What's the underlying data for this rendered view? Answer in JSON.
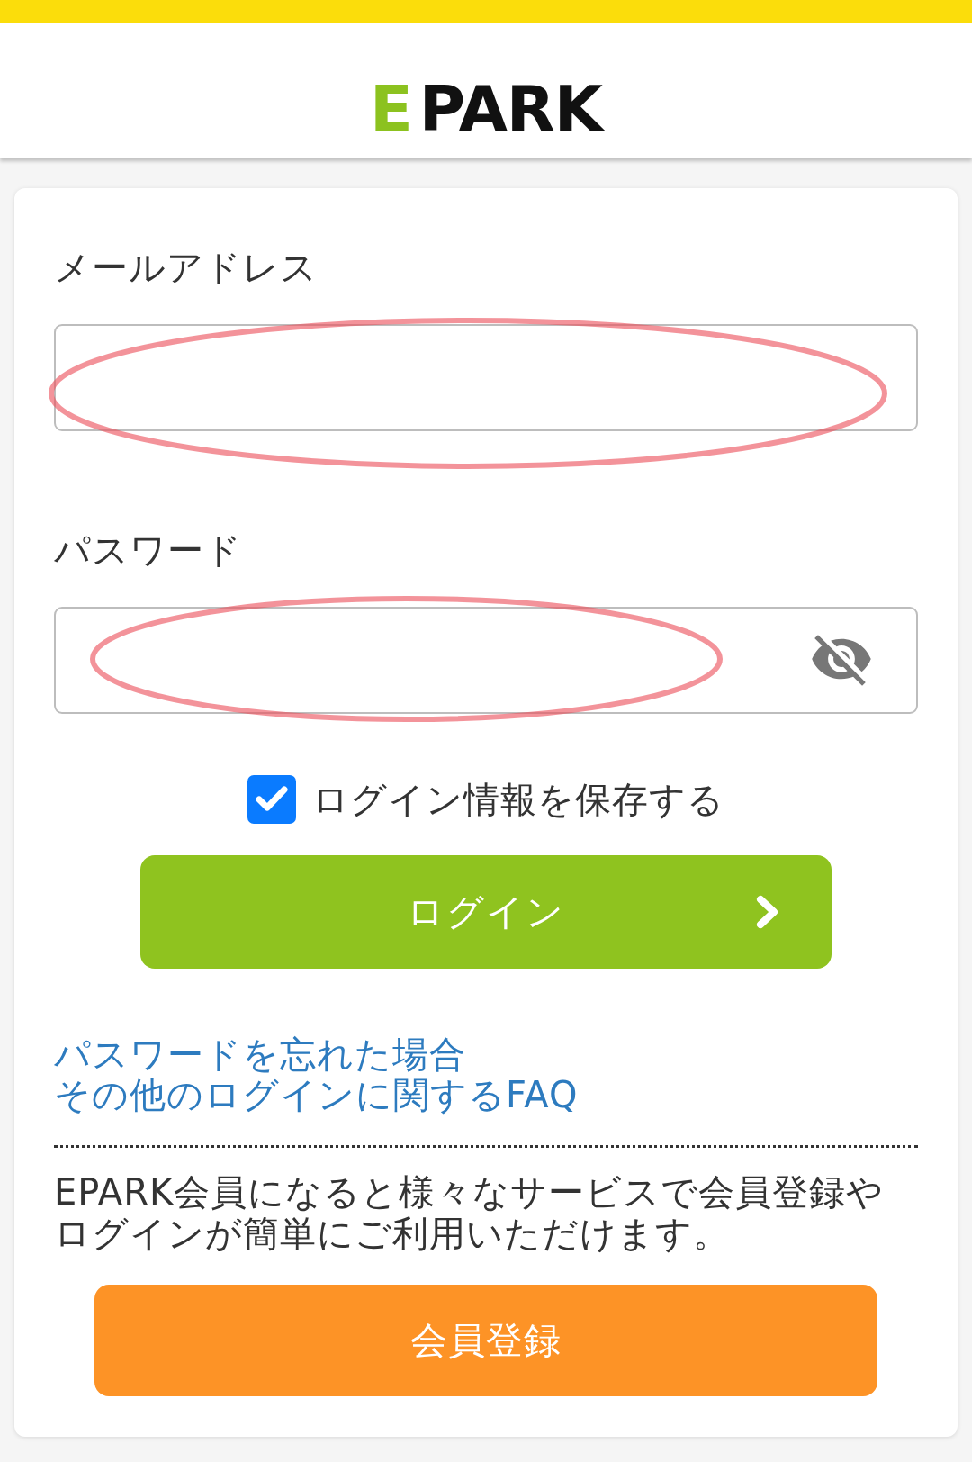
{
  "header": {
    "logo": {
      "accent": "E",
      "text": "PARK"
    }
  },
  "login_form": {
    "fields": [
      {
        "label": "メールアドレス",
        "kind": "email",
        "circled": true
      },
      {
        "label": "パスワード",
        "kind": "password",
        "circled": true
      }
    ],
    "remember_login": {
      "label": "ログイン情報を保存する",
      "checked": true
    },
    "login_button": "ログイン"
  },
  "links": [
    "パスワードを忘れた場合",
    "その他のログインに関するFAQ"
  ],
  "signup": {
    "description": "EPARK会員になると様々なサービスで会員登録やログインが簡単にご利用いただけます。",
    "button": "会員登録"
  }
}
